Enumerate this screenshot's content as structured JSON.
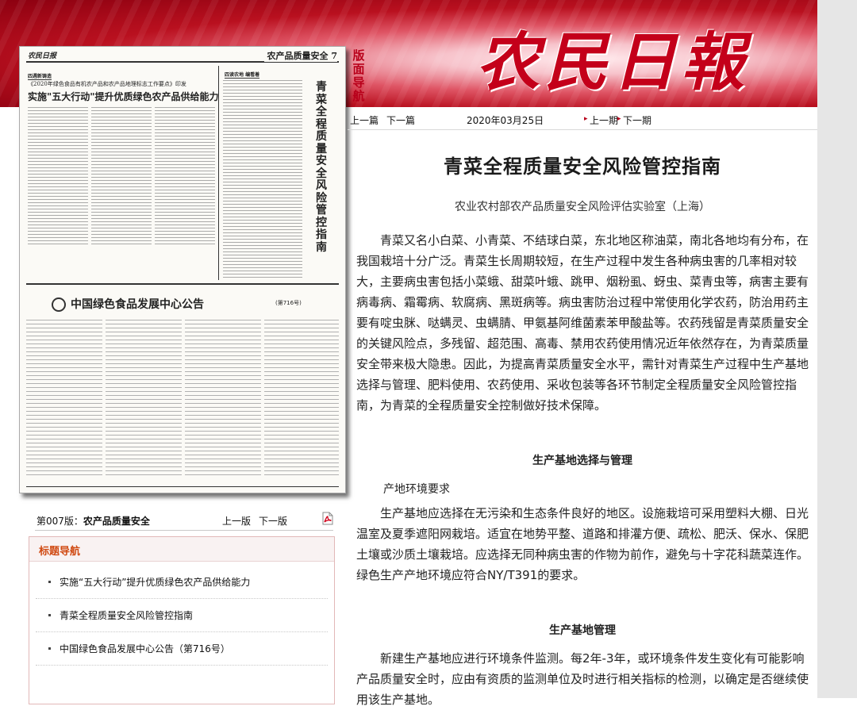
{
  "brand": {
    "name": "农民日報",
    "page_nav_tag": "版面导航"
  },
  "newspaper_thumbnail": {
    "masthead_logo": "农民日报",
    "section": "农产品质量安全",
    "page_number": "7",
    "kicker_left": "四週新铸造",
    "subheadline": "《2020年绿色食品有机农产品和农产品地理标志工作要点》印发",
    "headline": "实施\"五大行动\"提升优质绿色农产品供给能力",
    "kicker_right": "四读农地 编看着",
    "column_title": "青菜全程质量安全风险管控指南",
    "notice_title": "中国绿色食品发展中心公告",
    "notice_number": "(第716号)"
  },
  "toolbar": {
    "prev_article": "上一篇",
    "next_article": "下一篇",
    "date": "2020年03月25日",
    "prev_issue": "上一期",
    "next_issue": "下一期"
  },
  "article": {
    "title": "青菜全程质量安全风险管控指南",
    "author": "农业农村部农产品质量安全风险评估实验室（上海）",
    "intro": "青菜又名小白菜、小青菜、不结球白菜，东北地区称油菜，南北各地均有分布，在我国栽培十分广泛。青菜生长周期较短，在生产过程中发生各种病虫害的几率相对较大，主要病虫害包括小菜蛾、甜菜叶蛾、跳甲、烟粉虱、蚜虫、菜青虫等，病害主要有病毒病、霜霉病、软腐病、黑斑病等。病虫害防治过程中常使用化学农药，防治用药主要有啶虫脒、哒螨灵、虫螨腈、甲氨基阿维菌素苯甲酸盐等。农药残留是青菜质量安全的关键风险点，多残留、超范围、高毒、禁用农药使用情况近年依然存在，为青菜质量安全带来极大隐患。因此，为提高青菜质量安全水平，需针对青菜生产过程中生产基地选择与管理、肥料使用、农药使用、采收包装等各环节制定全程质量安全风险管控指南，为青菜的全程质量安全控制做好技术保障。",
    "section1_heading": "生产基地选择与管理",
    "sub1": "产地环境要求",
    "para1": "生产基地应选择在无污染和生态条件良好的地区。设施栽培可采用塑料大棚、日光温室及夏季遮阳网栽培。适宜在地势平整、道路和排灌方便、疏松、肥沃、保水、保肥土壤或沙质土壤栽培。应选择无同种病虫害的作物为前作，避免与十字花科蔬菜连作。绿色生产产地环境应符合NY/T391的要求。",
    "section2_heading": "生产基地管理",
    "para2": "新建生产基地应进行环境条件监测。每2年-3年，或环境条件发生变化有可能影响产品质量安全时，应由有资质的监测单位及时进行相关指标的检测，以确定是否继续使用该生产基地。"
  },
  "page_nav": {
    "page_label": "第007版：",
    "page_name": "农产品质量安全",
    "prev_page": "上一版",
    "next_page": "下一版"
  },
  "toc": {
    "heading": "标题导航",
    "items": [
      {
        "label": "实施“五大行动”提升优质绿色农产品供给能力"
      },
      {
        "label": "青菜全程质量安全风险管控指南"
      },
      {
        "label": "中国绿色食品发展中心公告（第716号）"
      }
    ]
  },
  "colors": {
    "accent": "#b8001a",
    "toc_heading": "#d04a12"
  }
}
